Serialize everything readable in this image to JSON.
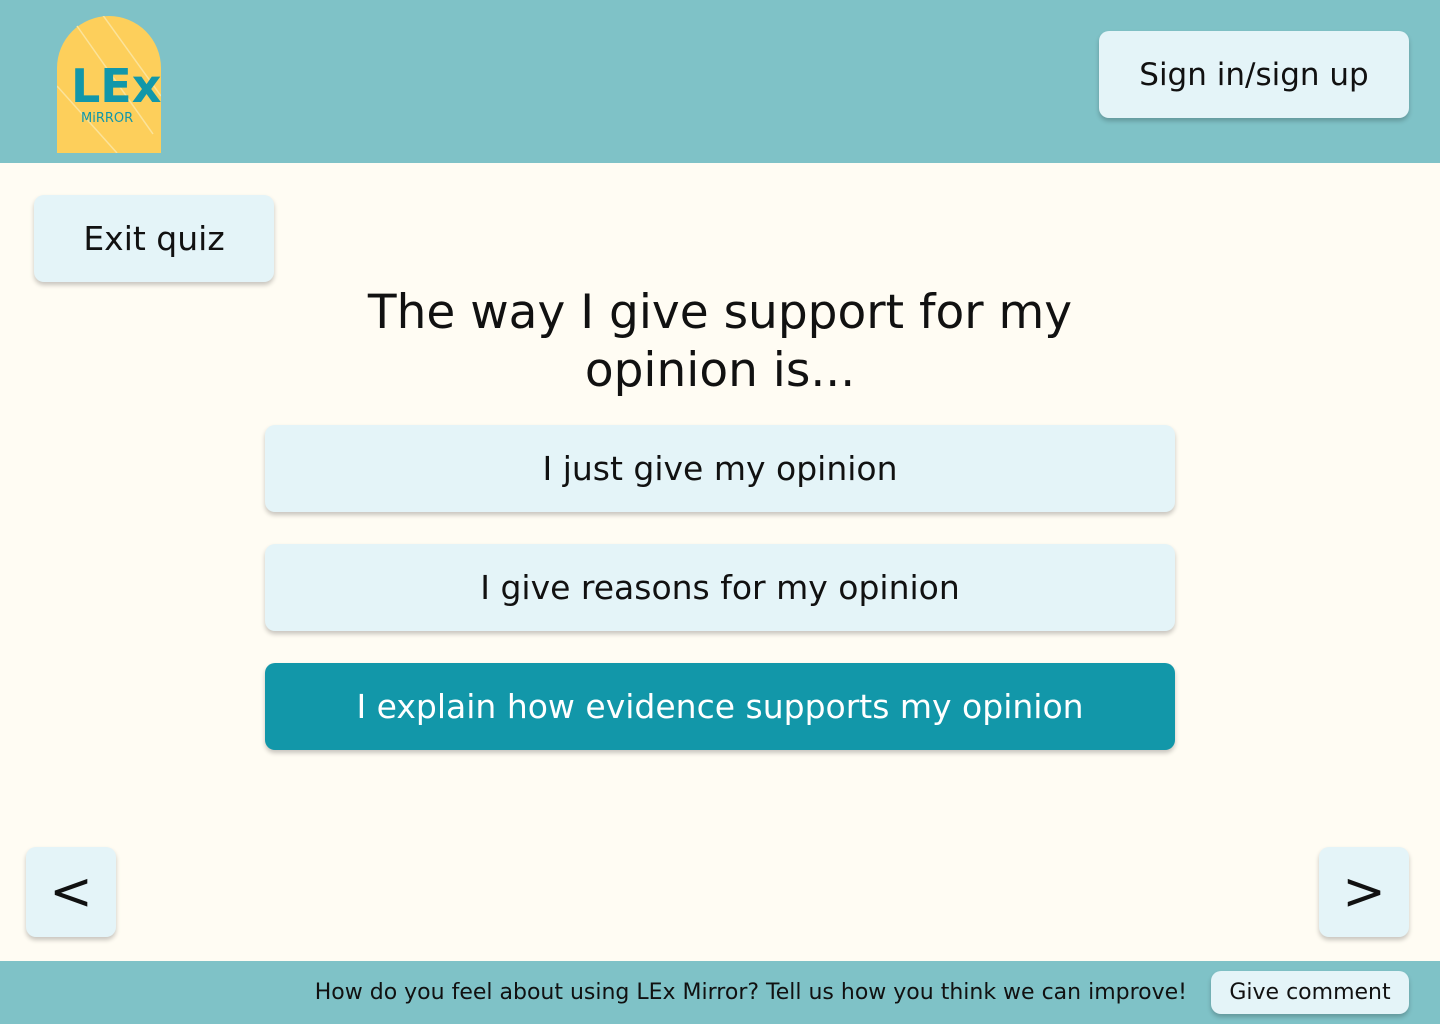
{
  "brand": {
    "logo_main": "LEx",
    "logo_sub": "MiRROR",
    "colors": {
      "logo_bg": "#FDCF5B",
      "logo_text": "#1297A9",
      "header_bg": "#7FC2C7"
    }
  },
  "header": {
    "sign_in_label": "Sign in/sign up"
  },
  "quiz": {
    "exit_label": "Exit quiz",
    "question": "The way I give support for my opinion is...",
    "options": [
      {
        "label": "I just give my opinion",
        "selected": false
      },
      {
        "label": "I give reasons for my opinion",
        "selected": false
      },
      {
        "label": "I explain how evidence supports my opinion",
        "selected": true
      }
    ],
    "prev_label": "<",
    "next_label": ">",
    "colors": {
      "option_bg": "#E4F4F8",
      "selected_bg": "#1297A9",
      "page_bg": "#FFFCF3"
    }
  },
  "footer": {
    "prompt": "How do you feel about using LEx Mirror? Tell us how you think we can improve!",
    "comment_label": "Give comment"
  }
}
